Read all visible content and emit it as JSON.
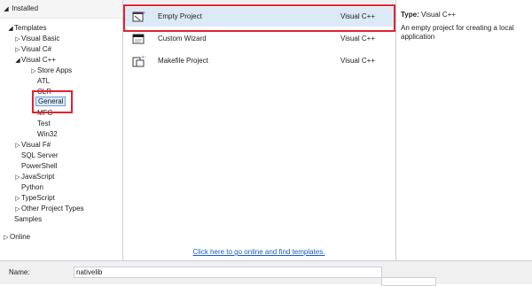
{
  "tree": {
    "installed_label": "Installed",
    "templates_label": "Templates",
    "visual_basic": "Visual Basic",
    "visual_csharp": "Visual C#",
    "visual_cpp": "Visual C++",
    "store_apps": "Store Apps",
    "atl": "ATL",
    "clr": "CLR",
    "general": "General",
    "mfc": "MFC",
    "test": "Test",
    "win32": "Win32",
    "visual_fsharp": "Visual F#",
    "sql_server": "SQL Server",
    "powershell": "PowerShell",
    "javascript": "JavaScript",
    "python": "Python",
    "typescript": "TypeScript",
    "other_project_types": "Other Project Types",
    "samples": "Samples",
    "online": "Online"
  },
  "templates": [
    {
      "name": "Empty Project",
      "language": "Visual C++"
    },
    {
      "name": "Custom Wizard",
      "language": "Visual C++"
    },
    {
      "name": "Makefile Project",
      "language": "Visual C++"
    }
  ],
  "online_link": "Click here to go online and find templates.",
  "details": {
    "type_label": "Type:",
    "type_value": "Visual C++",
    "description": "An empty project for creating a local application"
  },
  "bottom": {
    "name_label": "Name:",
    "name_value": "nativelib"
  },
  "colors": {
    "highlight_box": "#e0232f",
    "selection": "#dceaf7",
    "link": "#1a5bc4"
  }
}
